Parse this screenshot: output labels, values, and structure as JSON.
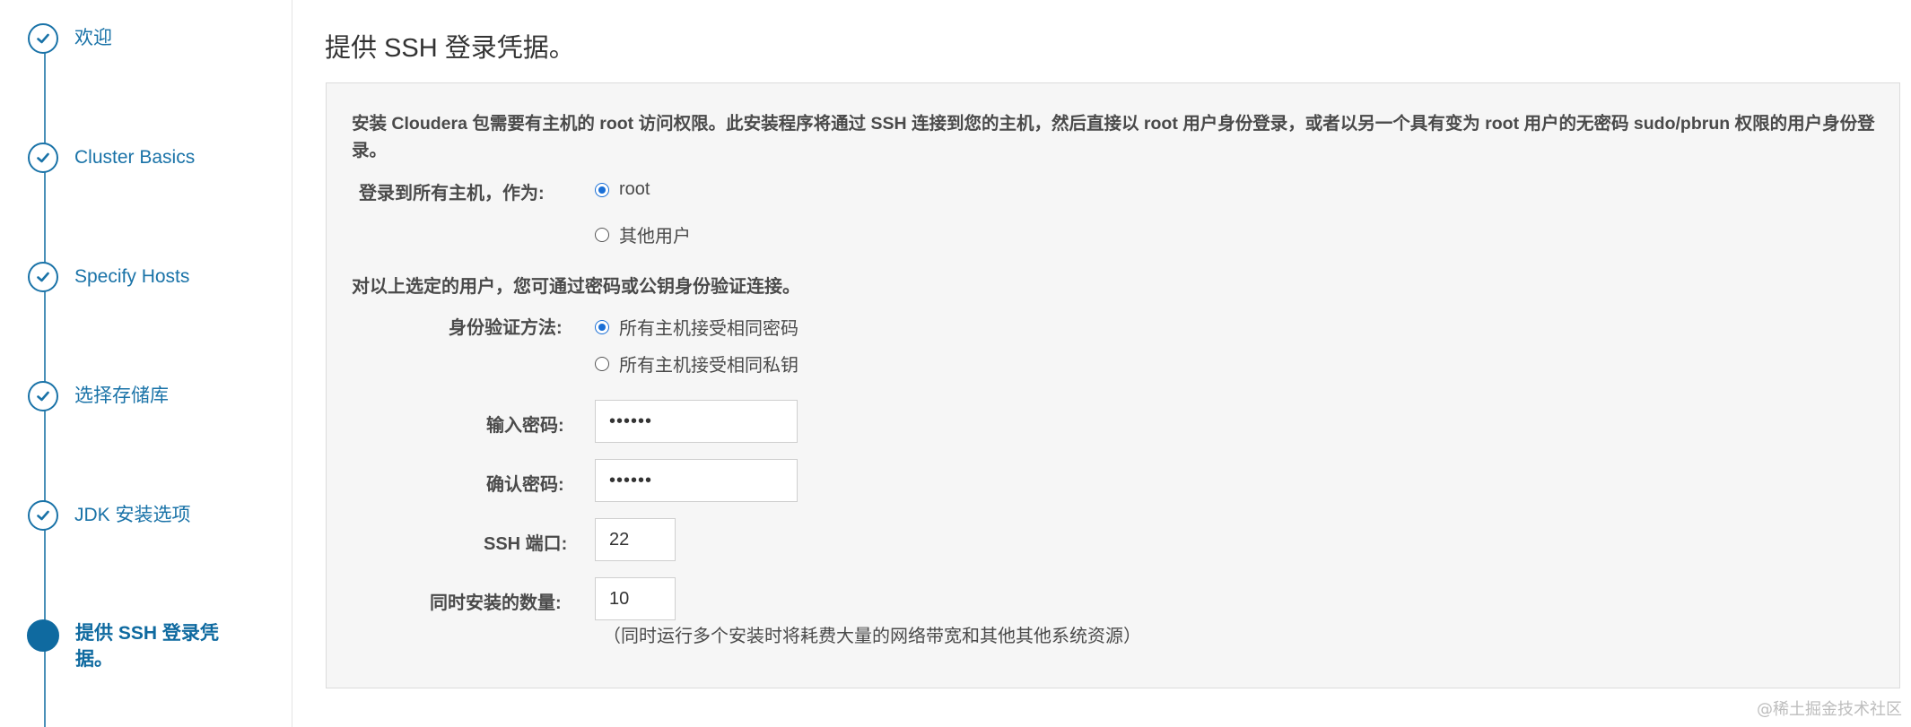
{
  "sidebar": {
    "steps": [
      {
        "label": "欢迎",
        "status": "completed"
      },
      {
        "label": "Cluster Basics",
        "status": "completed"
      },
      {
        "label": "Specify Hosts",
        "status": "completed"
      },
      {
        "label": "选择存储库",
        "status": "completed"
      },
      {
        "label": "JDK 安装选项",
        "status": "completed"
      },
      {
        "label": "提供 SSH 登录凭据。",
        "status": "current"
      }
    ]
  },
  "main": {
    "title": "提供 SSH 登录凭据。",
    "intro": "安装 Cloudera 包需要有主机的 root 访问权限。此安装程序将通过 SSH 连接到您的主机，然后直接以 root 用户身份登录，或者以另一个具有变为 root 用户的无密码 sudo/pbrun 权限的用户身份登录。",
    "login_as": {
      "label": "登录到所有主机，作为:",
      "options": [
        {
          "label": "root",
          "checked": true
        },
        {
          "label": "其他用户",
          "checked": false
        }
      ]
    },
    "auth_heading": "对以上选定的用户，您可通过密码或公钥身份验证连接。",
    "auth_method": {
      "label": "身份验证方法:",
      "options": [
        {
          "label": "所有主机接受相同密码",
          "checked": true
        },
        {
          "label": "所有主机接受相同私钥",
          "checked": false
        }
      ]
    },
    "password": {
      "label": "输入密码:",
      "value": "••••••"
    },
    "confirm_password": {
      "label": "确认密码:",
      "value": "••••••"
    },
    "ssh_port": {
      "label": "SSH 端口:",
      "value": "22"
    },
    "parallel_installs": {
      "label": "同时安装的数量:",
      "value": "10",
      "hint": "（同时运行多个安装时将耗费大量的网络带宽和其他其他系统资源）"
    }
  },
  "watermark": "@稀土掘金技术社区",
  "colors": {
    "accent": "#1a73a8",
    "active_step": "#0f6aa0",
    "radio_checked": "#1a6fd6",
    "panel_bg": "#f6f6f6"
  }
}
